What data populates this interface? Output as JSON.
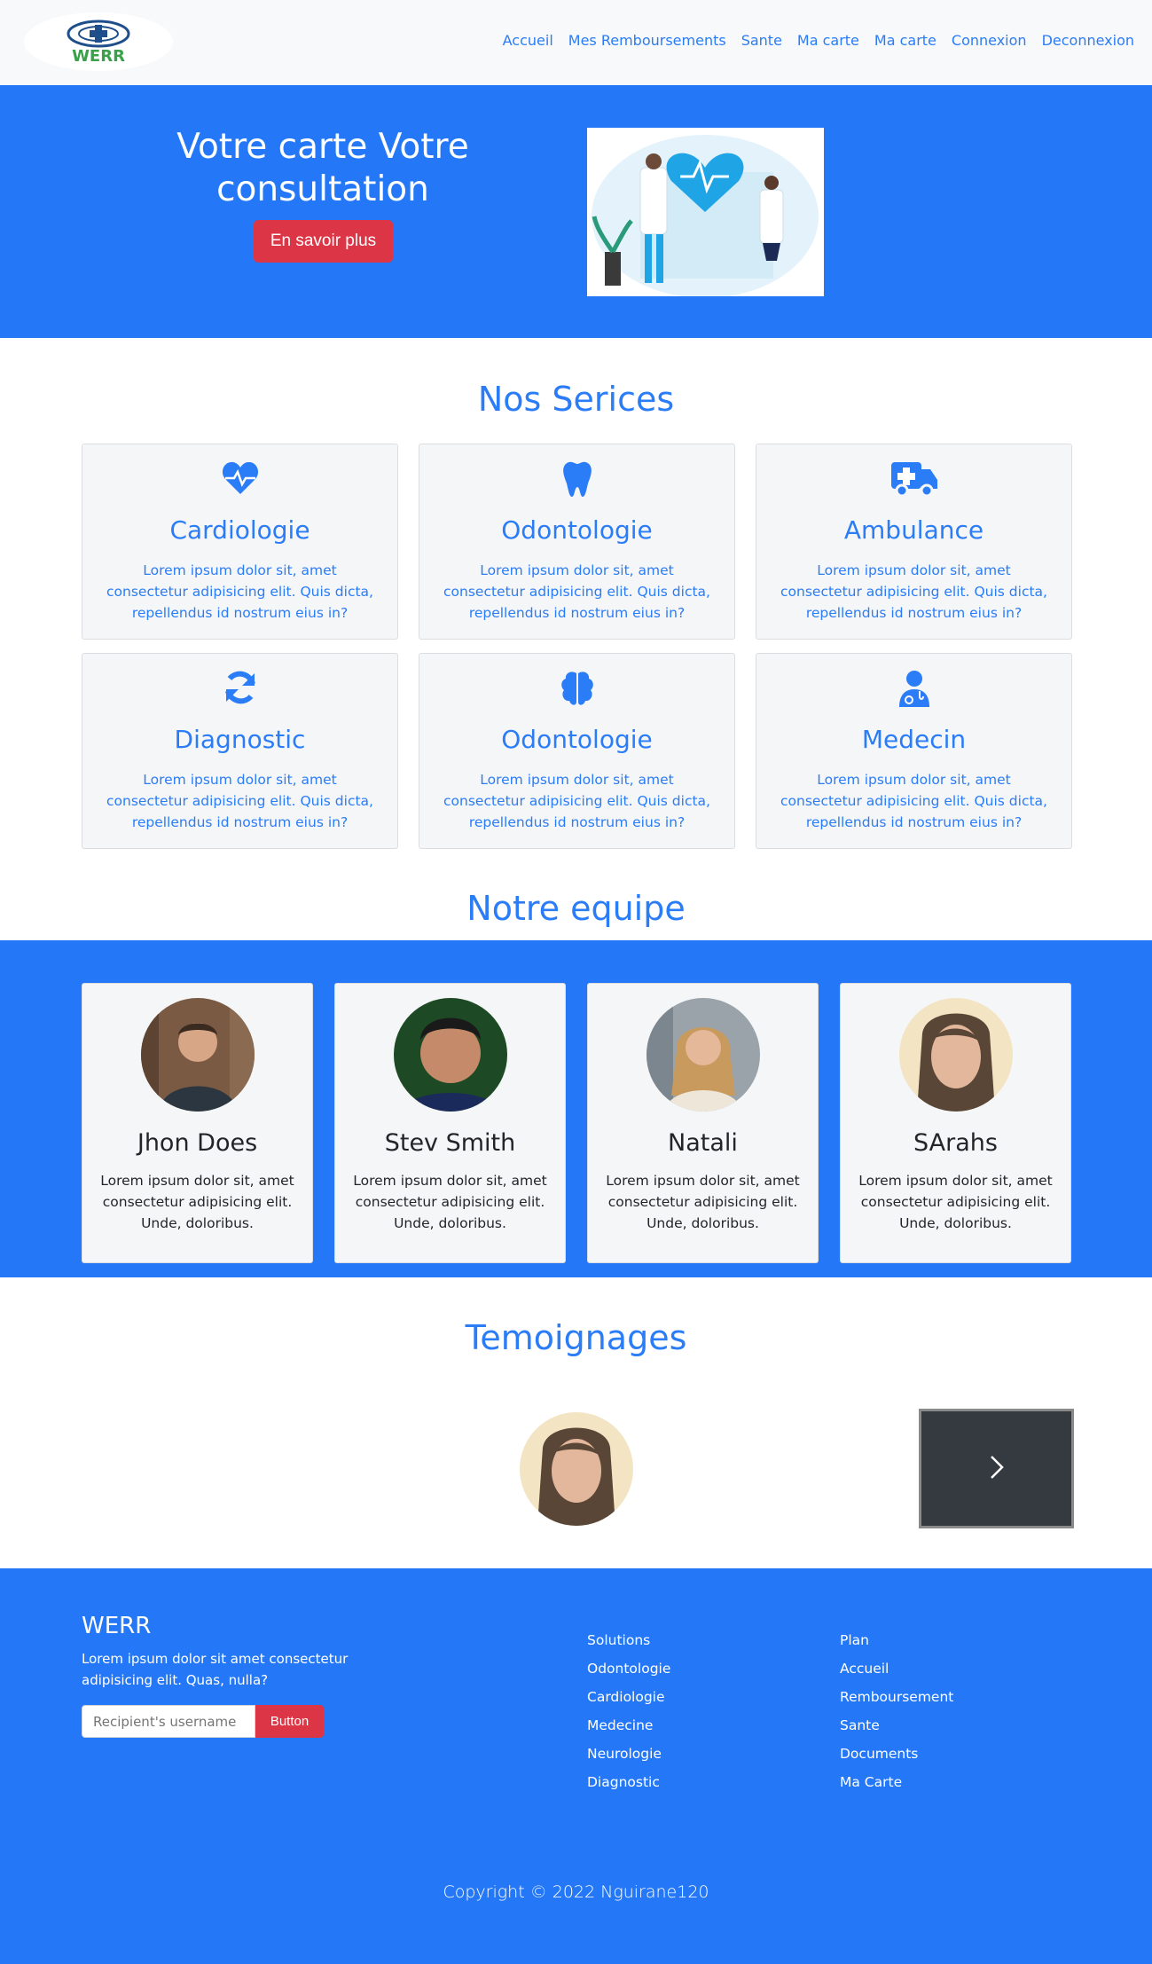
{
  "colors": {
    "primary": "#2478f7",
    "danger": "#dc3545",
    "light": "#f8f9fa",
    "dark": "#343a40"
  },
  "brand": {
    "logo_text": "WERR"
  },
  "nav": {
    "items": [
      "Accueil",
      "Mes Remboursements",
      "Sante",
      "Ma carte",
      "Ma carte",
      "Connexion",
      "Deconnexion"
    ]
  },
  "hero": {
    "title": "Votre carte Votre consultation",
    "button": "En savoir plus"
  },
  "services": {
    "title": "Nos Serices",
    "items": [
      {
        "icon": "heart-pulse-icon",
        "title": "Cardiologie",
        "text": "Lorem ipsum dolor sit, amet consectetur adipisicing elit. Quis dicta, repellendus id nostrum eius in?"
      },
      {
        "icon": "tooth-icon",
        "title": "Odontologie",
        "text": "Lorem ipsum dolor sit, amet consectetur adipisicing elit. Quis dicta, repellendus id nostrum eius in?"
      },
      {
        "icon": "ambulance-icon",
        "title": "Ambulance",
        "text": "Lorem ipsum dolor sit, amet consectetur adipisicing elit. Quis dicta, repellendus id nostrum eius in?"
      },
      {
        "icon": "sync-icon",
        "title": "Diagnostic",
        "text": "Lorem ipsum dolor sit, amet consectetur adipisicing elit. Quis dicta, repellendus id nostrum eius in?"
      },
      {
        "icon": "brain-icon",
        "title": "Odontologie",
        "text": "Lorem ipsum dolor sit, amet consectetur adipisicing elit. Quis dicta, repellendus id nostrum eius in?"
      },
      {
        "icon": "doctor-icon",
        "title": "Medecin",
        "text": "Lorem ipsum dolor sit, amet consectetur adipisicing elit. Quis dicta, repellendus id nostrum eius in?"
      }
    ]
  },
  "team": {
    "title": "Notre equipe",
    "members": [
      {
        "name": "Jhon Does",
        "text": "Lorem ipsum dolor sit, amet consectetur adipisicing elit. Unde, doloribus."
      },
      {
        "name": "Stev Smith",
        "text": "Lorem ipsum dolor sit, amet consectetur adipisicing elit. Unde, doloribus."
      },
      {
        "name": "Natali",
        "text": "Lorem ipsum dolor sit, amet consectetur adipisicing elit. Unde, doloribus."
      },
      {
        "name": "SArahs",
        "text": "Lorem ipsum dolor sit, amet consectetur adipisicing elit. Unde, doloribus."
      }
    ]
  },
  "testimonials": {
    "title": "Temoignages"
  },
  "footer": {
    "brand": "WERR",
    "desc": "Lorem ipsum dolor sit amet consectetur adipisicing elit. Quas, nulla?",
    "input_placeholder": "Recipient's username",
    "button": "Button",
    "col1": [
      "Solutions",
      "Odontologie",
      "Cardiologie",
      "Medecine",
      "Neurologie",
      "Diagnostic"
    ],
    "col2": [
      "Plan",
      "Accueil",
      "Remboursement",
      "Sante",
      "Documents",
      "Ma Carte"
    ],
    "copyright": "Copyright © 2022 Nguirane120"
  }
}
